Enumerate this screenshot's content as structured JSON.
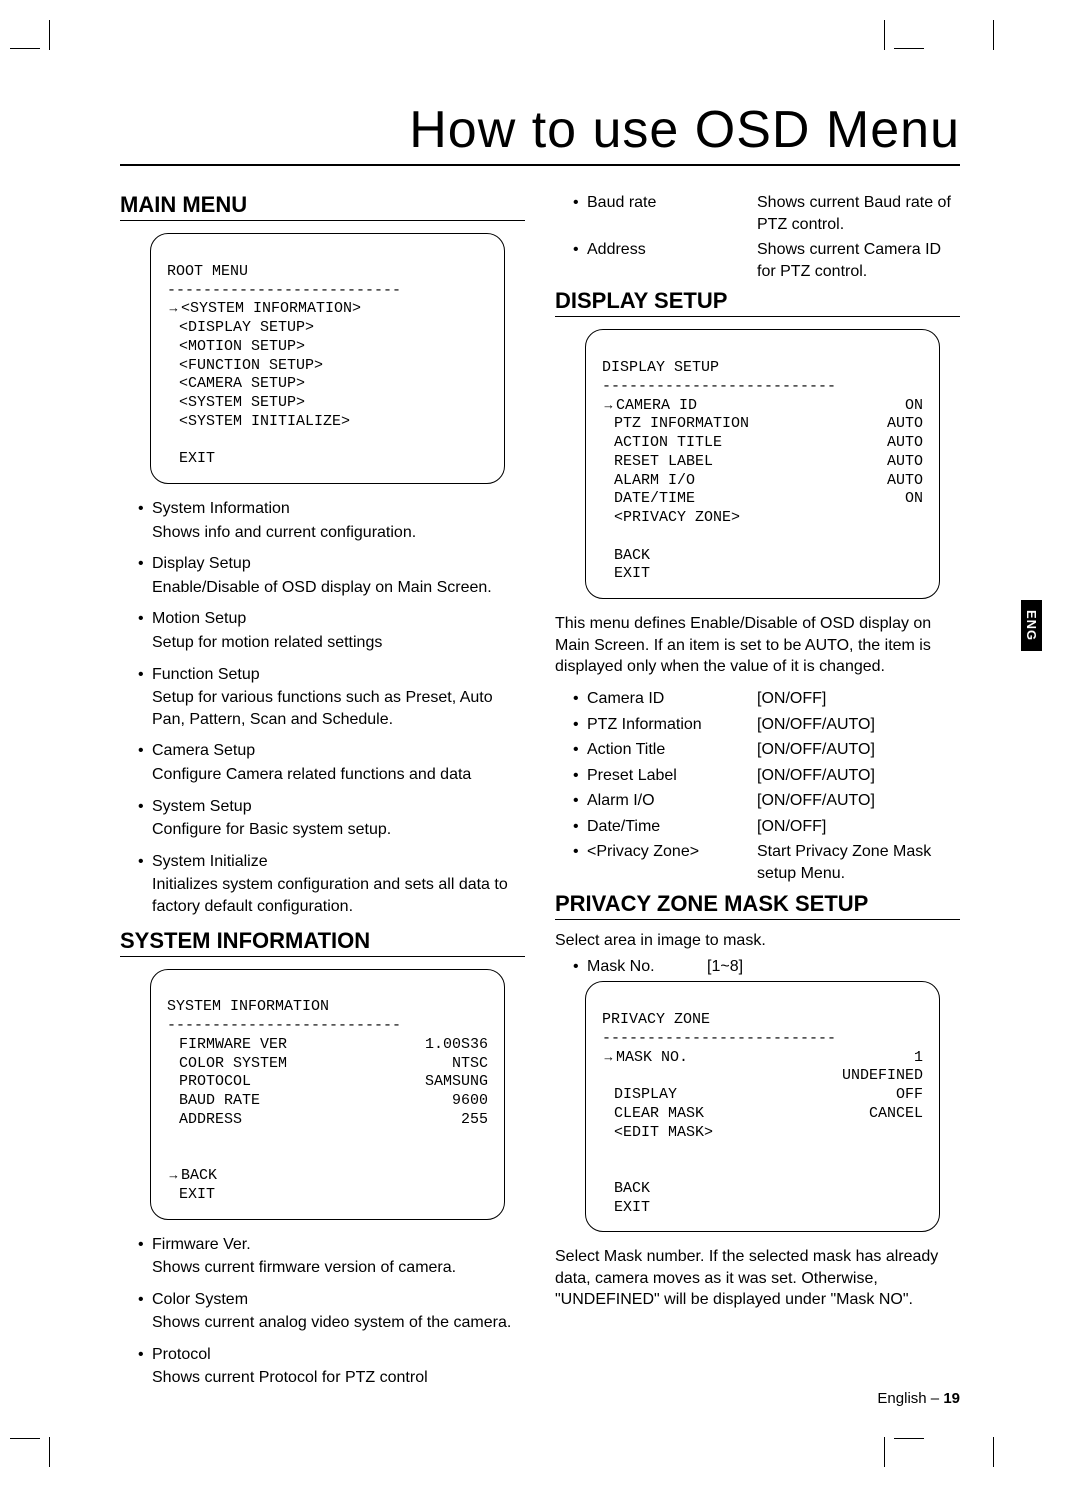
{
  "page_title": "How to use OSD Menu",
  "side_tab": "ENG",
  "footer": {
    "lang": "English –",
    "page": "19"
  },
  "left": {
    "main_menu_heading": "MAIN MENU",
    "root_menu": {
      "title": "ROOT MENU",
      "hr": "--------------------------",
      "items": [
        "<SYSTEM INFORMATION>",
        "<DISPLAY SETUP>",
        "<MOTION SETUP>",
        "<FUNCTION SETUP>",
        "<CAMERA SETUP>",
        "<SYSTEM SETUP>",
        "<SYSTEM INITIALIZE>"
      ],
      "exit": "EXIT"
    },
    "main_menu_desc": [
      {
        "t": "System Information",
        "d": "Shows info and current configuration."
      },
      {
        "t": "Display Setup",
        "d": "Enable/Disable of OSD display on Main Screen."
      },
      {
        "t": "Motion Setup",
        "d": "Setup for motion related settings"
      },
      {
        "t": "Function Setup",
        "d": "Setup for various functions such as Preset, Auto Pan, Pattern, Scan and Schedule."
      },
      {
        "t": "Camera Setup",
        "d": "Configure Camera related functions and data"
      },
      {
        "t": "System Setup",
        "d": "Configure for Basic system setup."
      },
      {
        "t": "System Initialize",
        "d": "Initializes system configuration and sets all data to factory default configuration."
      }
    ],
    "sysinfo_heading": "SYSTEM INFORMATION",
    "sysinfo_box": {
      "title": "SYSTEM INFORMATION",
      "hr": "--------------------------",
      "rows": [
        {
          "l": "FIRMWARE VER",
          "v": "1.00S36"
        },
        {
          "l": "COLOR SYSTEM",
          "v": "NTSC"
        },
        {
          "l": "PROTOCOL",
          "v": "SAMSUNG"
        },
        {
          "l": "BAUD RATE",
          "v": "9600"
        },
        {
          "l": "ADDRESS",
          "v": "255"
        }
      ],
      "back": "BACK",
      "exit": "EXIT"
    },
    "sysinfo_desc": [
      {
        "t": "Firmware Ver.",
        "d": "Shows current firmware version of camera."
      },
      {
        "t": "Color System",
        "d": "Shows current analog video system of the camera."
      },
      {
        "t": "Protocol",
        "d": "Shows current Protocol for PTZ control"
      }
    ]
  },
  "right": {
    "top_kv": [
      {
        "k": "Baud rate",
        "v": "Shows current Baud rate of PTZ control."
      },
      {
        "k": "Address",
        "v": "Shows current Camera ID for PTZ control."
      }
    ],
    "display_heading": "DISPLAY SETUP",
    "display_box": {
      "title": "DISPLAY SETUP",
      "hr": "--------------------------",
      "rows": [
        {
          "l": "CAMERA ID",
          "v": "ON"
        },
        {
          "l": "PTZ INFORMATION",
          "v": "AUTO"
        },
        {
          "l": "ACTION TITLE",
          "v": "AUTO"
        },
        {
          "l": "RESET LABEL",
          "v": "AUTO"
        },
        {
          "l": "ALARM I/O",
          "v": "AUTO"
        },
        {
          "l": "DATE/TIME",
          "v": "ON"
        },
        {
          "l": "<PRIVACY ZONE>",
          "v": ""
        }
      ],
      "back": "BACK",
      "exit": "EXIT"
    },
    "display_note": "This menu defines Enable/Disable of OSD display on Main Screen. If an item is set to be AUTO, the item is displayed only when the value of it is changed.",
    "display_kv": [
      {
        "k": "Camera ID",
        "v": "[ON/OFF]"
      },
      {
        "k": "PTZ Information",
        "v": "[ON/OFF/AUTO]"
      },
      {
        "k": "Action Title",
        "v": "[ON/OFF/AUTO]"
      },
      {
        "k": "Preset Label",
        "v": "[ON/OFF/AUTO]"
      },
      {
        "k": "Alarm I/O",
        "v": "[ON/OFF/AUTO]"
      },
      {
        "k": "Date/Time",
        "v": "[ON/OFF]"
      },
      {
        "k": "<Privacy Zone>",
        "v": "Start Privacy Zone Mask setup Menu."
      }
    ],
    "privacy_heading": "PRIVACY ZONE MASK SETUP",
    "privacy_subtitle": "Select area in image to mask.",
    "privacy_kv": [
      {
        "k": "Mask No.",
        "v": "[1~8]"
      }
    ],
    "privacy_box": {
      "title": "PRIVACY ZONE",
      "hr": "--------------------------",
      "rows": [
        {
          "l": "MASK NO.",
          "v": "1"
        },
        {
          "l": "",
          "v": "UNDEFINED"
        },
        {
          "l": "DISPLAY",
          "v": "OFF"
        },
        {
          "l": "CLEAR MASK",
          "v": "CANCEL"
        },
        {
          "l": "<EDIT MASK>",
          "v": ""
        }
      ],
      "back": "BACK",
      "exit": "EXIT"
    },
    "privacy_note": "Select Mask number. If the selected mask has already data, camera moves as it was set. Otherwise, \"UNDEFINED\" will be displayed under \"Mask NO\"."
  }
}
